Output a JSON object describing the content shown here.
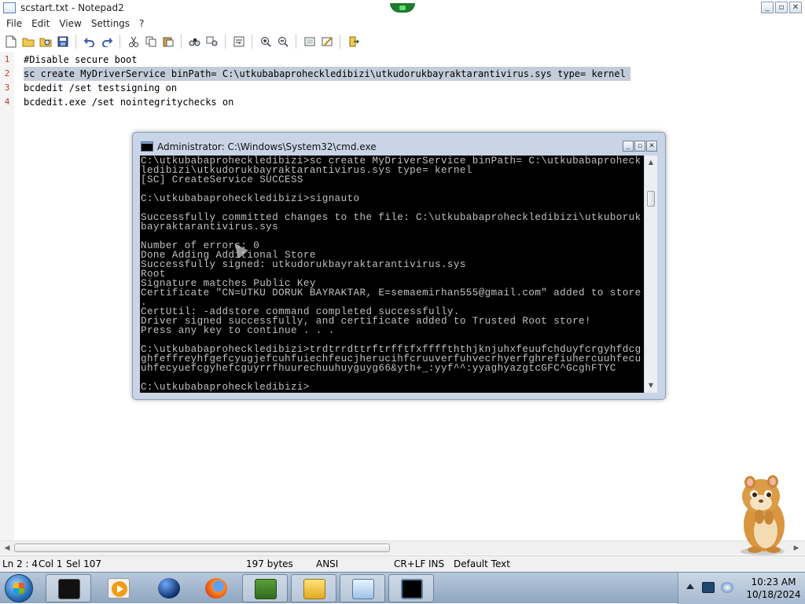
{
  "window": {
    "title": "scstart.txt - Notepad2"
  },
  "window_controls": {
    "minimize": "_",
    "maximize": "▫",
    "close": "✕"
  },
  "menu": [
    "File",
    "Edit",
    "View",
    "Settings",
    "?"
  ],
  "toolbar": {
    "icons": [
      "new-file-icon",
      "open-folder-icon",
      "browse-icon",
      "save-icon",
      "undo-icon",
      "redo-icon",
      "cut-icon",
      "copy-icon",
      "paste-icon",
      "find-icon",
      "replace-icon",
      "word-wrap-icon",
      "zoom-in-icon",
      "zoom-out-icon",
      "view-icon",
      "settings-icon",
      "exit-icon"
    ]
  },
  "editor": {
    "selected_line": 2,
    "lines": [
      {
        "num": "1",
        "text": "#Disable secure boot"
      },
      {
        "num": "2",
        "text": "sc create MyDriverService binPath= C:\\utkubabaproheckledibizi\\utkudorukbayraktarantivirus.sys type= kernel"
      },
      {
        "num": "3",
        "text": "bcdedit /set testsigning on"
      },
      {
        "num": "4",
        "text": "bcdedit.exe /set nointegritychecks on"
      }
    ]
  },
  "status": {
    "position": "Ln 2 : 4",
    "col": "Col 1",
    "sel": "Sel 107",
    "size": "197 bytes",
    "encoding": "ANSI",
    "eol": "CR+LF",
    "ins": "INS",
    "scheme": "Default Text"
  },
  "cmd": {
    "title": "Administrator: C:\\Windows\\System32\\cmd.exe",
    "lines": [
      "C:\\utkubabaproheckledibizi>sc create MyDriverService binPath= C:\\utkubabaproheck",
      "ledibizi\\utkudorukbayraktarantivirus.sys type= kernel",
      "[SC] CreateService SUCCESS",
      "",
      "C:\\utkubabaproheckledibizi>signauto",
      "",
      "Successfully committed changes to the file: C:\\utkubabaproheckledibizi\\utkuboruk",
      "bayraktarantivirus.sys",
      "",
      "Number of errors: 0",
      "Done Adding Additional Store",
      "Successfully signed: utkudorukbayraktarantivirus.sys",
      "Root",
      "Signature matches Public Key",
      "Certificate \"CN=UTKU DORUK BAYRAKTAR, E=semaemirhan555@gmail.com\" added to store",
      ".",
      "CertUtil: -addstore command completed successfully.",
      "Driver signed successfully, and certificate added to Trusted Root store!",
      "Press any key to continue . . .",
      "",
      "C:\\utkubabaproheckledibizi>trdtrrdttrftrfftfxffffththjknjuhxfeuufchduyfcrgyhfdcg",
      "ghfeffreyhfgefcyugjefcuhfuiechfeucjherucihfcruuverfuhvecrhyerfghrefiuhercuuhfecu",
      "uhfecyuefcgyhefcguyrrfhuurechuuhuyguyg66&yth+_:yyf^^:yyaghyazgtcGFC^GcghFTYC",
      "",
      "C:\\utkubabaproheckledibizi>"
    ]
  },
  "taskbar": {
    "apps": [
      "terminal-app",
      "media-player-app",
      "globe-app",
      "firefox-app",
      "bonzi-box-app",
      "folder-app",
      "notepad2-app",
      "cmd-app"
    ],
    "clock_time": "10:23 AM",
    "clock_date": "10/18/2024"
  },
  "colors": {
    "selection": "#c3cdd9",
    "line_numbers": "#c0392b",
    "console_bg": "#000000",
    "console_fg": "#c0c0c0"
  }
}
